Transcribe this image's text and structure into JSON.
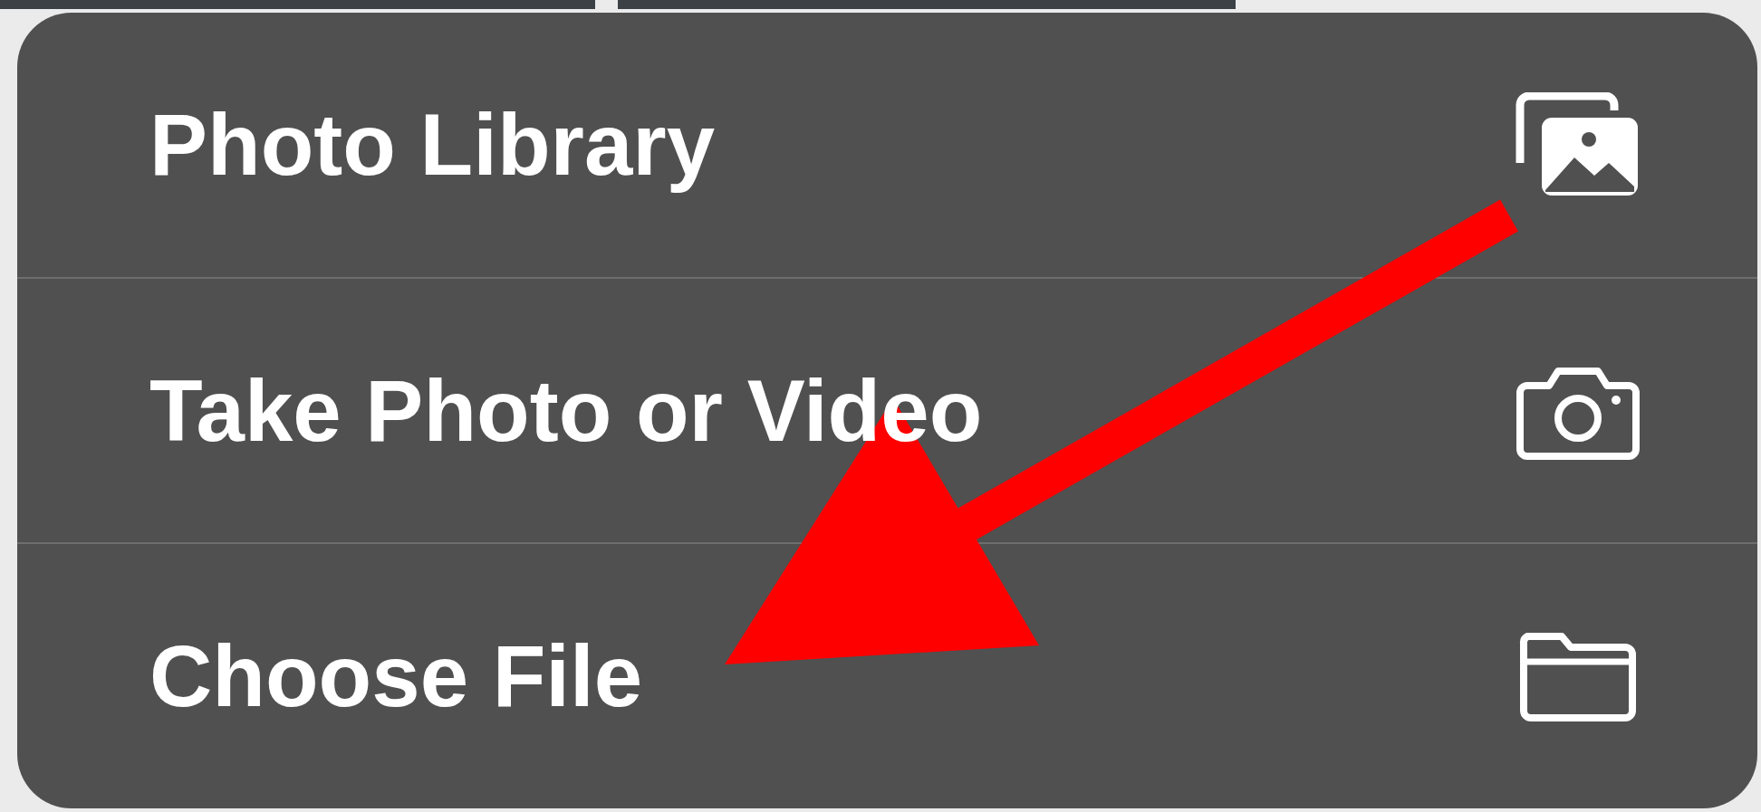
{
  "menu": {
    "items": [
      {
        "label": "Photo Library",
        "kind": "photos"
      },
      {
        "label": "Take Photo or Video",
        "kind": "camera"
      },
      {
        "label": "Choose File",
        "kind": "folder"
      }
    ]
  }
}
